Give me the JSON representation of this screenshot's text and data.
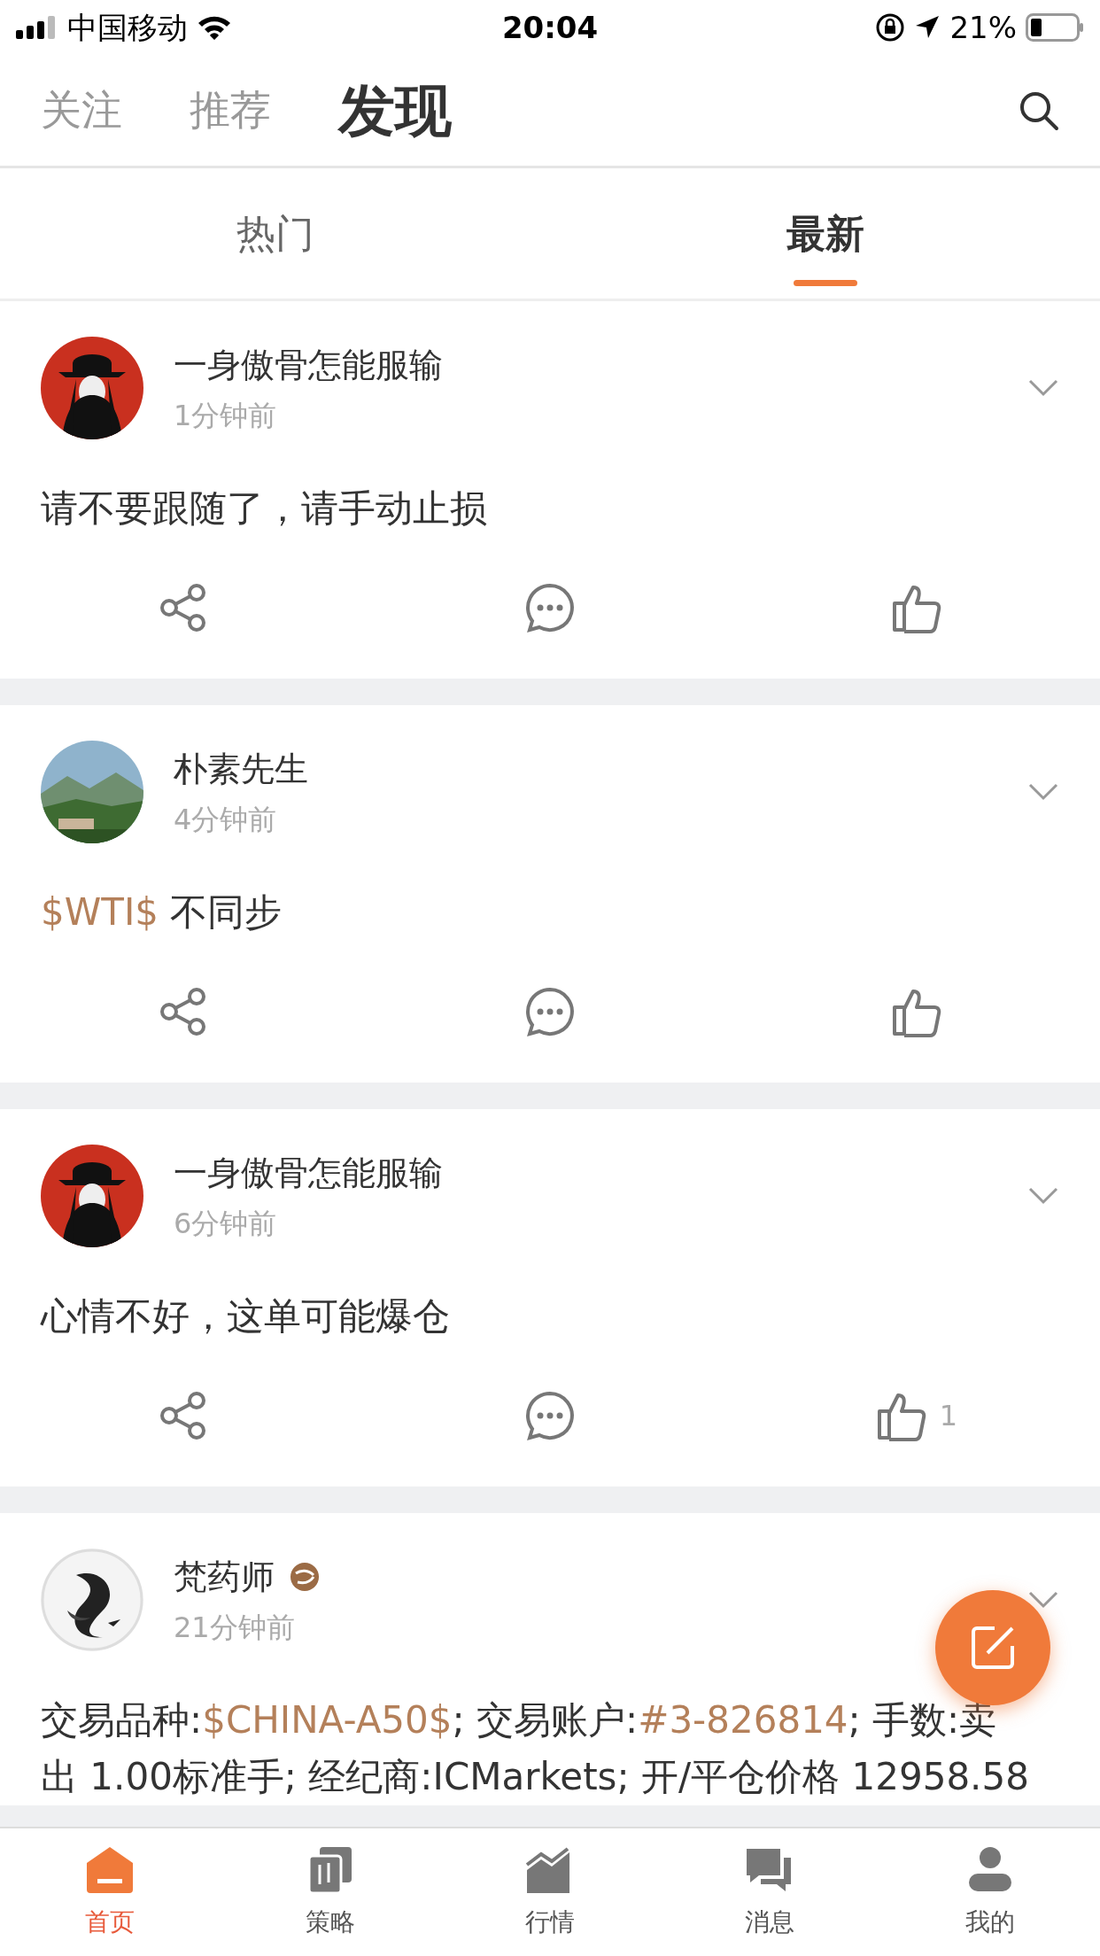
{
  "status_bar": {
    "carrier": "中国移动",
    "time": "20:04",
    "battery": "21%"
  },
  "header_tabs": [
    {
      "label": "关注",
      "selected": false
    },
    {
      "label": "推荐",
      "selected": false
    },
    {
      "label": "发现",
      "selected": true
    }
  ],
  "sub_tabs": [
    {
      "label": "热门",
      "selected": false
    },
    {
      "label": "最新",
      "selected": true
    }
  ],
  "posts": [
    {
      "author": "一身傲骨怎能服输",
      "badge": false,
      "time": "1分钟前",
      "lines": [
        [
          {
            "kind": "text",
            "text": "请不要跟随了，请手动止损"
          }
        ]
      ]
    },
    {
      "author": "朴素先生",
      "badge": false,
      "time": "4分钟前",
      "lines": [
        [
          {
            "kind": "tag",
            "text": "$WTI$"
          },
          {
            "kind": "text",
            "text": " 不同步"
          }
        ]
      ]
    },
    {
      "author": "一身傲骨怎能服输",
      "badge": false,
      "time": "6分钟前",
      "lines": [
        [
          {
            "kind": "text",
            "text": "心情不好，这单可能爆仓"
          }
        ]
      ],
      "like_count": "1"
    },
    {
      "author": "梵药师",
      "badge": true,
      "time": "21分钟前",
      "lines": [
        [
          {
            "kind": "text",
            "text": "交易品种:"
          },
          {
            "kind": "tag",
            "text": "$CHINA-A50$"
          },
          {
            "kind": "text",
            "text": "; 交易账户:"
          },
          {
            "kind": "tag",
            "text": "#3-826814"
          },
          {
            "kind": "text",
            "text": "; 手数:卖"
          }
        ],
        [
          {
            "kind": "text",
            "text": "出 1.00标准手; 经纪商:ICMarkets; 开/平仓价格 12958.58"
          }
        ]
      ]
    }
  ],
  "bottom_nav": [
    {
      "label": "首页",
      "selected": true
    },
    {
      "label": "策略",
      "selected": false
    },
    {
      "label": "行情",
      "selected": false
    },
    {
      "label": "消息",
      "selected": false
    },
    {
      "label": "我的",
      "selected": false
    }
  ]
}
